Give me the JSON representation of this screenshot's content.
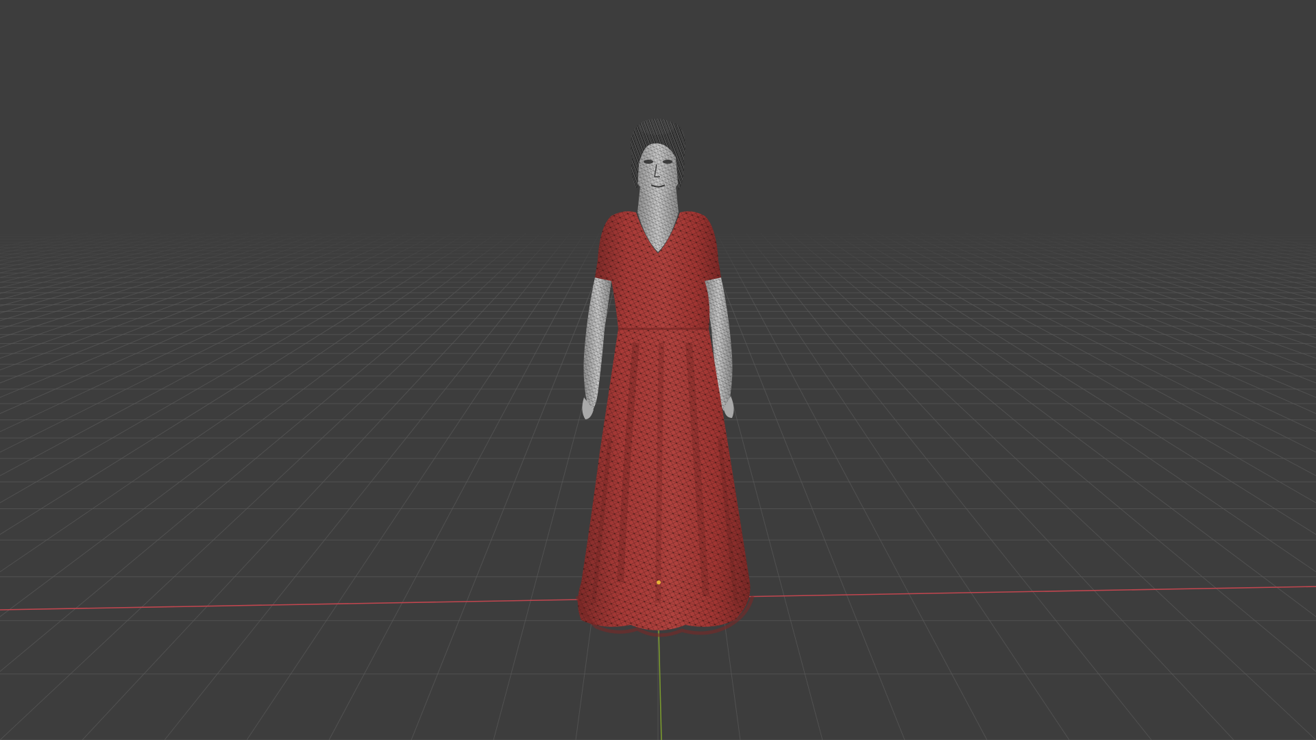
{
  "viewport": {
    "mode": "3d-viewport",
    "background_color": "#3d3d3d",
    "grid_color": "#5a5a5a",
    "x_axis_color": "#c2464f",
    "y_axis_color": "#7a9a2e",
    "origin_marker_color": "#e8b33a"
  },
  "model": {
    "object": "character-wireframe-woman-red-dress",
    "dress_color": "#a83a37",
    "dress_shadow_color": "#7e2a28",
    "dress_wire_color": "#3a1512",
    "skin_color": "#c4c4c4",
    "skin_shadow_color": "#8f8f8f",
    "skin_wire_color": "#2a2a2a",
    "hair_color": "#2c2c2c",
    "hair_highlight_color": "#7a7a7a"
  }
}
